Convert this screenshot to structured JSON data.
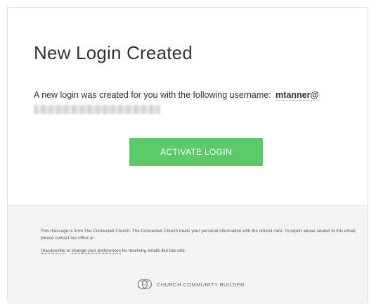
{
  "email": {
    "title": "New Login Created",
    "message_prefix": "A new login was created for you with the following username:",
    "username": "mtanner@",
    "button_label": "ACTIVATE LOGIN"
  },
  "footer": {
    "notice": "This message is from The Connected Church. The Connected Church treats your personal information with the utmost care. To report abuse related to this email, please contact our office at .",
    "unsubscribe_label": "Unsubscribe",
    "or_text": "or",
    "preferences_label": "change your preferences",
    "preferences_suffix": "for receiving emails like this one.",
    "brand_name": "CHURCH COMMUNITY BUILDER"
  },
  "colors": {
    "button": "#5cc96b",
    "footer_bg": "#f4f4f4",
    "text": "#333333"
  },
  "icons": {
    "brand": "church-community-builder-logo-icon"
  }
}
